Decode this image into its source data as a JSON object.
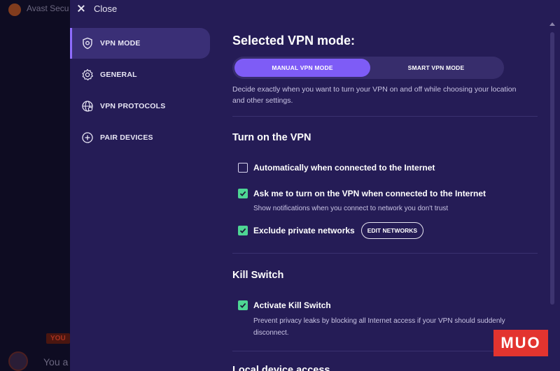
{
  "background_app": {
    "title": "Avast Secu",
    "badge": "YOU",
    "text": "You a"
  },
  "topbar": {
    "close_label": "Close"
  },
  "sidebar": {
    "items": [
      {
        "label": "VPN MODE",
        "icon": "shield-icon",
        "active": true
      },
      {
        "label": "GENERAL",
        "icon": "gear-icon",
        "active": false
      },
      {
        "label": "VPN PROTOCOLS",
        "icon": "globe-icon",
        "active": false
      },
      {
        "label": "PAIR DEVICES",
        "icon": "plus-circle-icon",
        "active": false
      }
    ]
  },
  "vpn_mode": {
    "title": "Selected VPN mode:",
    "manual_label": "MANUAL VPN MODE",
    "smart_label": "SMART VPN MODE",
    "selected": "MANUAL VPN MODE",
    "description_line1": "Decide exactly when you want to turn your VPN on and off while choosing your location",
    "description_line2": "and other settings."
  },
  "turn_on": {
    "title": "Turn on the VPN",
    "options": [
      {
        "label": "Automatically when connected to the Internet",
        "checked": false
      },
      {
        "label": "Ask me to turn on the VPN when connected to the Internet",
        "checked": true,
        "description": "Show notifications when you connect to network you don't trust"
      },
      {
        "label": "Exclude private networks",
        "checked": true,
        "button": "EDIT NETWORKS"
      }
    ]
  },
  "kill_switch": {
    "title": "Kill Switch",
    "option_label": "Activate Kill Switch",
    "checked": true,
    "description_line1": "Prevent privacy leaks by blocking all Internet access if your VPN should suddenly",
    "description_line2": "disconnect."
  },
  "local_access": {
    "title": "Local device access"
  },
  "watermark": {
    "text": "MUO"
  },
  "colors": {
    "panel_bg": "#251c56",
    "accent": "#7e5cf6",
    "check_green": "#4ed694",
    "watermark_red": "#e3342f"
  }
}
